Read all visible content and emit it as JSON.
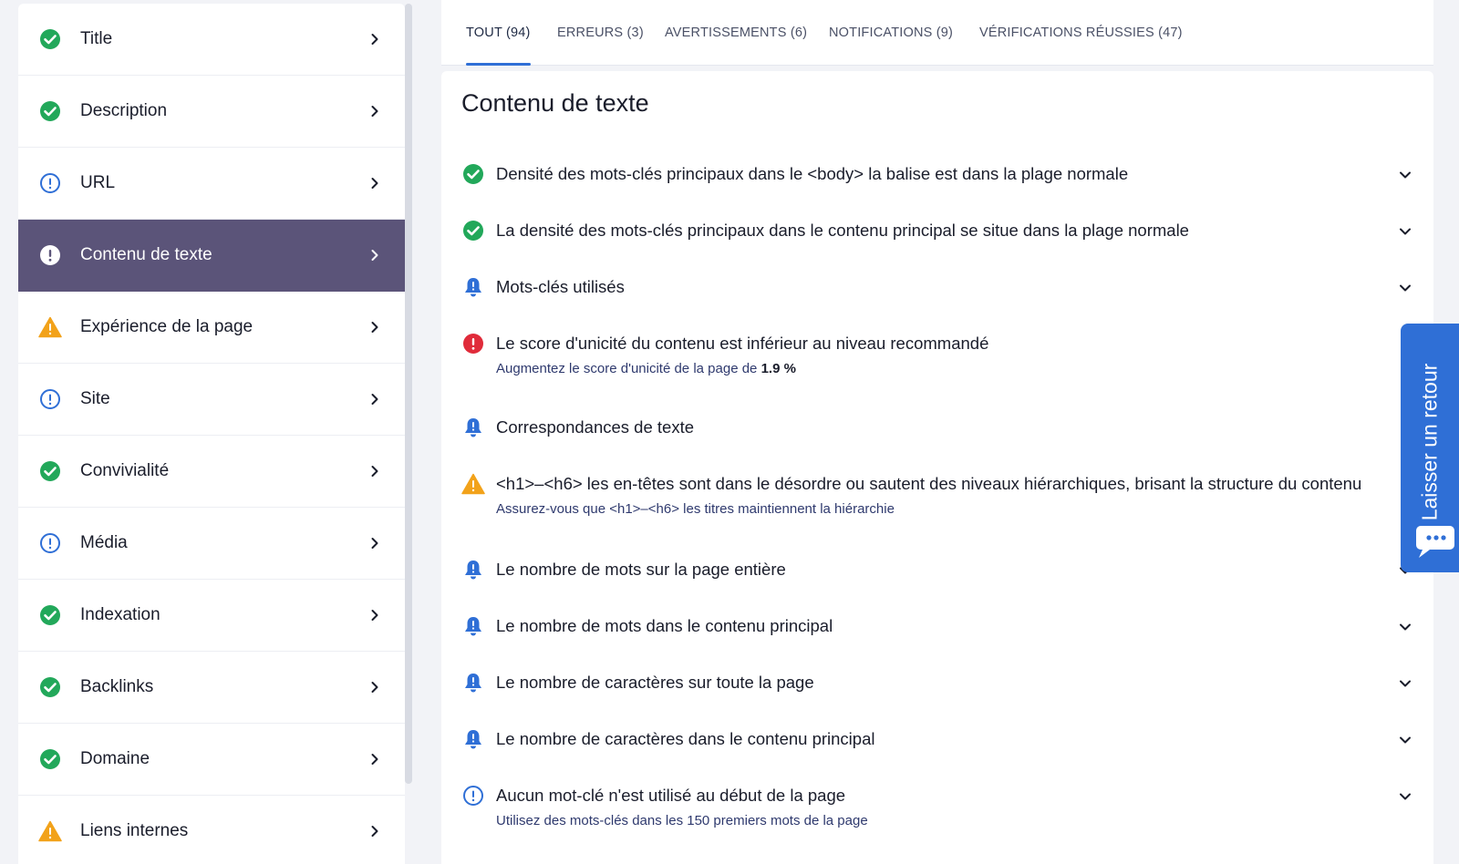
{
  "colors": {
    "success": "#22a85a",
    "info": "#2f6fd6",
    "warning": "#f2a21a",
    "error": "#e02b3a",
    "active_bg": "#5b5479",
    "accent": "#2f6fd6"
  },
  "sidebar": {
    "items": [
      {
        "label": "Title",
        "status": "success",
        "icon": "check-circle-icon"
      },
      {
        "label": "Description",
        "status": "success",
        "icon": "check-circle-icon"
      },
      {
        "label": "URL",
        "status": "info",
        "icon": "info-circle-icon"
      },
      {
        "label": "Contenu de texte",
        "status": "active",
        "icon": "exclamation-circle-icon"
      },
      {
        "label": "Expérience de la page",
        "status": "warning",
        "icon": "warning-triangle-icon"
      },
      {
        "label": "Site",
        "status": "info",
        "icon": "info-circle-icon"
      },
      {
        "label": "Convivialité",
        "status": "success",
        "icon": "check-circle-icon"
      },
      {
        "label": "Média",
        "status": "info",
        "icon": "info-circle-icon"
      },
      {
        "label": "Indexation",
        "status": "success",
        "icon": "check-circle-icon"
      },
      {
        "label": "Backlinks",
        "status": "success",
        "icon": "check-circle-icon"
      },
      {
        "label": "Domaine",
        "status": "success",
        "icon": "check-circle-icon"
      },
      {
        "label": "Liens internes",
        "status": "warning",
        "icon": "warning-triangle-icon"
      }
    ]
  },
  "tabs": [
    {
      "label": "TOUT (94)",
      "active": true
    },
    {
      "label": "ERREURS (3)",
      "active": false
    },
    {
      "label": "AVERTISSEMENTS (6)",
      "active": false
    },
    {
      "label": "NOTIFICATIONS (9)",
      "active": false
    },
    {
      "label": "VÉRIFICATIONS RÉUSSIES (47)",
      "active": false
    }
  ],
  "main": {
    "title": "Contenu de texte",
    "checks": [
      {
        "title": "Densité des mots-clés principaux dans le <body> la balise est dans la plage normale",
        "status": "success",
        "icon": "check-circle-icon"
      },
      {
        "title": "La densité des mots-clés principaux dans le contenu principal se situe dans la plage normale",
        "status": "success",
        "icon": "check-circle-icon"
      },
      {
        "title": "Mots-clés utilisés",
        "status": "notification",
        "icon": "bell-icon"
      },
      {
        "title": "Le score d'unicité du contenu est inférieur au niveau recommandé",
        "status": "error",
        "icon": "error-circle-icon",
        "subtitle": "Augmentez le score d'unicité de la page de",
        "subtitle_value": "1.9 %"
      },
      {
        "title": "Correspondances de texte",
        "status": "notification",
        "icon": "bell-icon"
      },
      {
        "title": "<h1>–<h6> les en-têtes sont dans le désordre ou sautent des niveaux hiérarchiques, brisant la structure du contenu",
        "status": "warning",
        "icon": "warning-triangle-icon",
        "subtitle": "Assurez-vous que <h1>–<h6> les titres maintiennent la hiérarchie"
      },
      {
        "title": "Le nombre de mots sur la page entière",
        "status": "notification",
        "icon": "bell-icon"
      },
      {
        "title": "Le nombre de mots dans le contenu principal",
        "status": "notification",
        "icon": "bell-icon"
      },
      {
        "title": "Le nombre de caractères sur toute la page",
        "status": "notification",
        "icon": "bell-icon"
      },
      {
        "title": "Le nombre de caractères dans le contenu principal",
        "status": "notification",
        "icon": "bell-icon"
      },
      {
        "title": "Aucun mot-clé n'est utilisé au début de la page",
        "status": "info",
        "icon": "info-circle-icon",
        "subtitle": "Utilisez des mots-clés dans les 150 premiers mots de la page"
      }
    ]
  },
  "feedback": {
    "label": "Laisser un retour",
    "icon": "chat-bubble-icon"
  }
}
